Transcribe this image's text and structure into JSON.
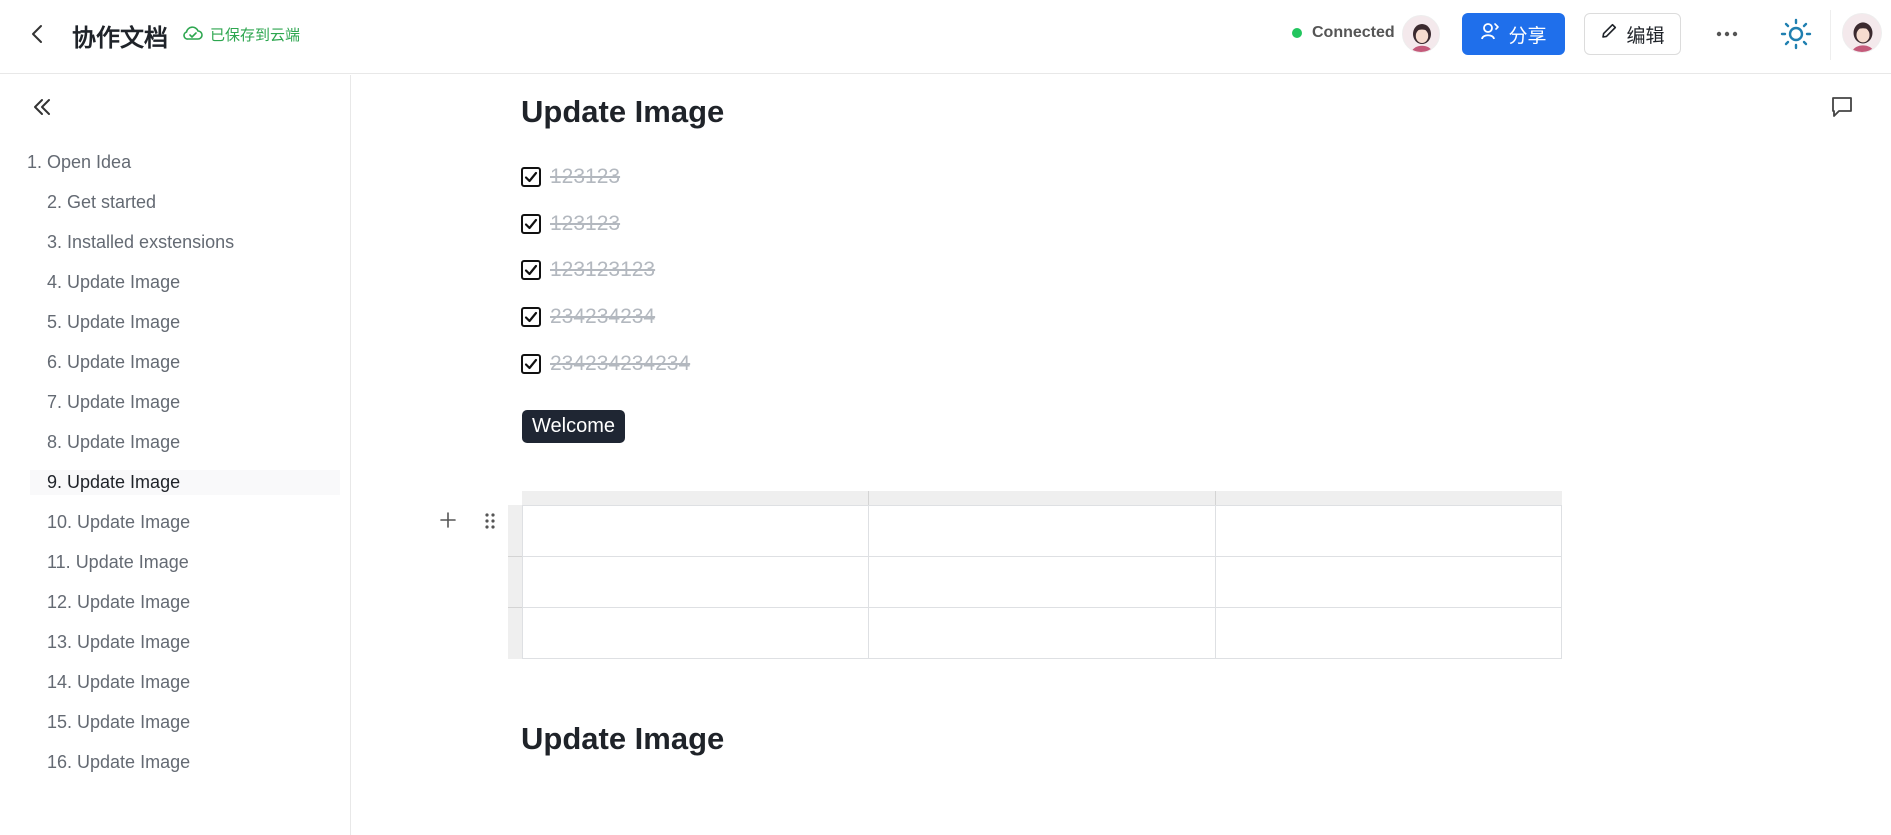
{
  "header": {
    "title": "协作文档",
    "save_status": "已保存到云端",
    "connection": "Connected",
    "share_label": "分享",
    "edit_label": "编辑",
    "colors": {
      "primary": "#1f6feb",
      "success": "#2da64f",
      "dot": "#22c55e"
    }
  },
  "sidebar": {
    "items": [
      {
        "label": "1. Open Idea"
      },
      {
        "label": "2. Get started"
      },
      {
        "label": "3. Installed exstensions"
      },
      {
        "label": "4. Update Image"
      },
      {
        "label": "5. Update Image"
      },
      {
        "label": "6. Update Image"
      },
      {
        "label": "7. Update Image"
      },
      {
        "label": "8. Update Image"
      },
      {
        "label": "9. Update Image"
      },
      {
        "label": "10. Update Image"
      },
      {
        "label": "11. Update Image"
      },
      {
        "label": "12. Update Image"
      },
      {
        "label": "13. Update Image"
      },
      {
        "label": "14. Update Image"
      },
      {
        "label": "15. Update Image"
      },
      {
        "label": "16. Update Image"
      }
    ],
    "active_index": 8
  },
  "content": {
    "heading1": "Update Image",
    "tasks": [
      {
        "text": "123123",
        "checked": true
      },
      {
        "text": "123123",
        "checked": true
      },
      {
        "text": "123123123",
        "checked": true
      },
      {
        "text": "234234234",
        "checked": true
      },
      {
        "text": "234234234234",
        "checked": true
      }
    ],
    "tag": "Welcome",
    "table": {
      "rows": 3,
      "cols": 3
    },
    "heading2": "Update Image"
  }
}
